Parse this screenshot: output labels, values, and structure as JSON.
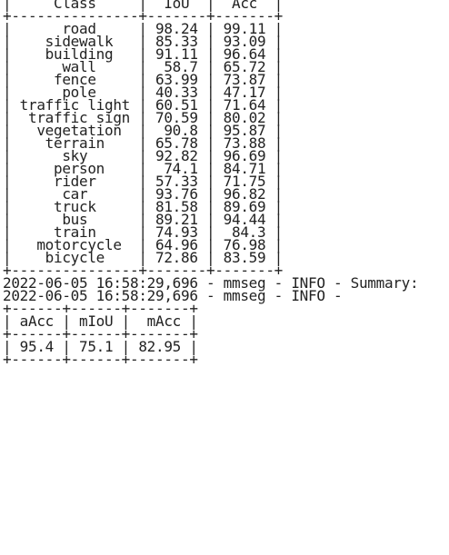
{
  "terminal": {
    "lines": [
      "|     Class     |  IoU  |  Acc  |",
      "+---------------+-------+-------+",
      "|      road     | 98.24 | 99.11 |",
      "|    sidewalk   | 85.33 | 93.09 |",
      "|    building   | 91.11 | 96.64 |",
      "|      wall     |  58.7 | 65.72 |",
      "|     fence     | 63.99 | 73.87 |",
      "|      pole     | 40.33 | 47.17 |",
      "| traffic light | 60.51 | 71.64 |",
      "|  traffic sign | 70.59 | 80.02 |",
      "|   vegetation  |  90.8 | 95.87 |",
      "|    terrain    | 65.78 | 73.88 |",
      "|      sky      | 92.82 | 96.69 |",
      "|     person    |  74.1 | 84.71 |",
      "|     rider     | 57.33 | 71.75 |",
      "|      car      | 93.76 | 96.82 |",
      "|     truck     | 81.58 | 89.69 |",
      "|      bus      | 89.21 | 94.44 |",
      "|     train     | 74.93 |  84.3 |",
      "|   motorcycle  | 64.96 | 76.98 |",
      "|    bicycle    | 72.86 | 83.59 |",
      "+---------------+-------+-------+",
      "2022-06-05 16:58:29,696 - mmseg - INFO - Summary:",
      "2022-06-05 16:58:29,696 - mmseg - INFO - ",
      "+------+------+-------+",
      "| aAcc | mIoU |  mAcc |",
      "+------+------+-------+",
      "| 95.4 | 75.1 | 82.95 |",
      "+------+------+-------+"
    ]
  }
}
